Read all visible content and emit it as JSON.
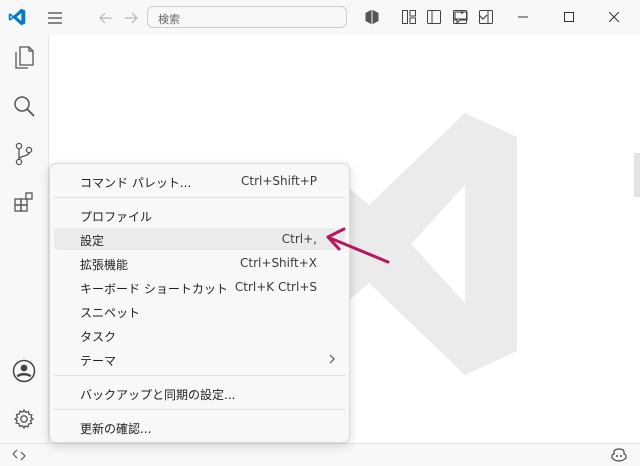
{
  "titlebar": {
    "search_placeholder": "検索"
  },
  "menu": {
    "groups": [
      [
        {
          "label": "コマンド パレット...",
          "shortcut": "Ctrl+Shift+P"
        }
      ],
      [
        {
          "label": "プロファイル",
          "shortcut": ""
        },
        {
          "label": "設定",
          "shortcut": "Ctrl+,",
          "active": true
        },
        {
          "label": "拡張機能",
          "shortcut": "Ctrl+Shift+X"
        },
        {
          "label": "キーボード ショートカット",
          "shortcut": "Ctrl+K Ctrl+S"
        },
        {
          "label": "スニペット",
          "shortcut": ""
        },
        {
          "label": "タスク",
          "shortcut": ""
        },
        {
          "label": "テーマ",
          "shortcut": "",
          "submenu": true
        }
      ],
      [
        {
          "label": "バックアップと同期の設定...",
          "shortcut": ""
        }
      ],
      [
        {
          "label": "更新の確認...",
          "shortcut": ""
        }
      ]
    ]
  },
  "icons": {
    "titlebar": [
      "vscode-logo-icon",
      "menu-icon",
      "back-arrow-icon",
      "forward-arrow-icon",
      "chat-icon",
      "chevron-down-icon",
      "extensions-icon",
      "customize-layout-icon",
      "toggle-primary-sidebar-icon",
      "toggle-panel-icon",
      "toggle-secondary-sidebar-icon",
      "minimize-icon",
      "maximize-icon",
      "close-icon"
    ],
    "activitybar": [
      "explorer-icon",
      "search-icon",
      "source-control-icon",
      "extensions-icon",
      "accounts-icon",
      "manage-gear-icon"
    ],
    "statusbar": [
      "remote-icon",
      "copilot-icon"
    ]
  },
  "colors": {
    "vscode_blue": "#007acc",
    "annotation_arrow": "#b5175e",
    "menu_highlight": "#ebebeb",
    "watermark": "#ebebeb"
  }
}
